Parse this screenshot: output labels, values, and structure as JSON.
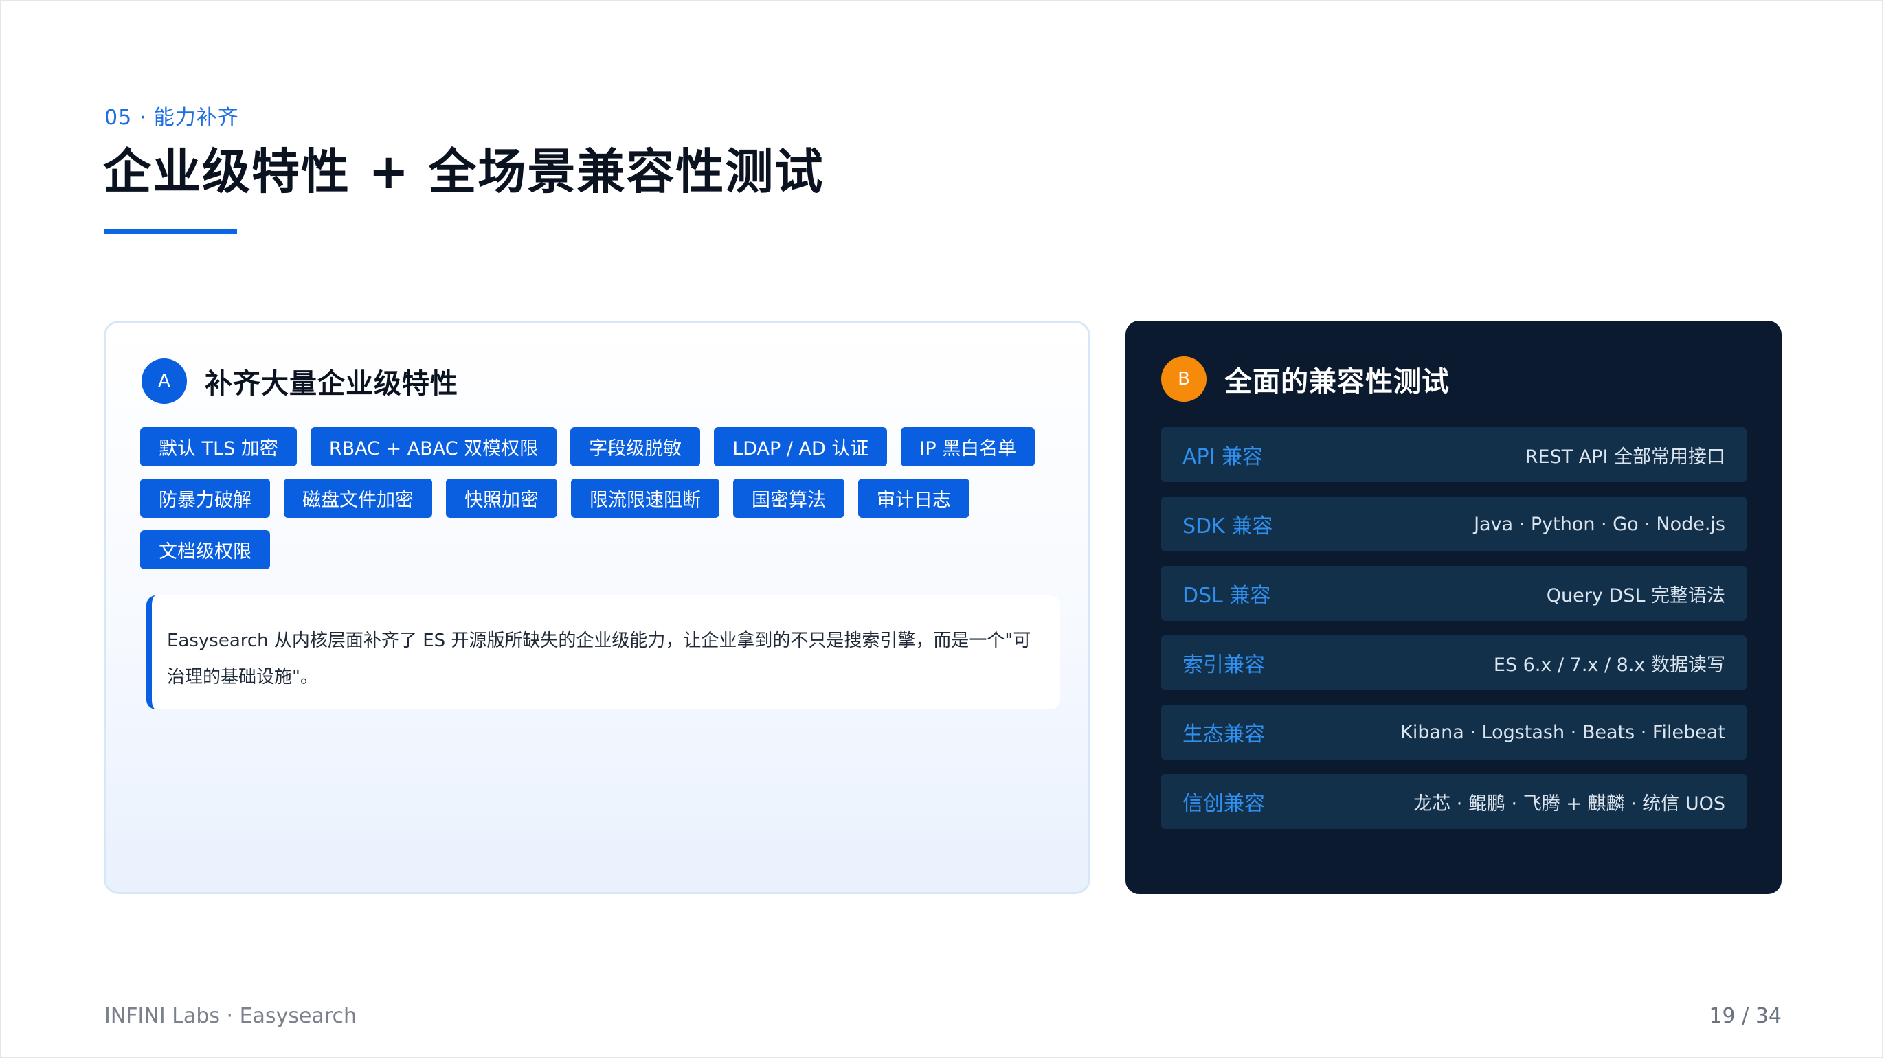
{
  "section_label": "05 · 能力补齐",
  "title": "企业级特性 + 全场景兼容性测试",
  "panel_a": {
    "badge": "A",
    "heading": "补齐大量企业级特性",
    "tags": [
      "默认 TLS 加密",
      "RBAC + ABAC 双模权限",
      "字段级脱敏",
      "LDAP / AD 认证",
      "IP 黑白名单",
      "防暴力破解",
      "磁盘文件加密",
      "快照加密",
      "限流限速阻断",
      "国密算法",
      "审计日志",
      "文档级权限"
    ],
    "quote": "Easysearch 从内核层面补齐了 ES 开源版所缺失的企业级能力，让企业拿到的不只是搜索引擎，而是一个\"可治理的基础设施\"。"
  },
  "panel_b": {
    "badge": "B",
    "heading": "全面的兼容性测试",
    "rows": [
      {
        "label": "API 兼容",
        "value": "REST API 全部常用接口"
      },
      {
        "label": "SDK 兼容",
        "value": "Java · Python · Go · Node.js"
      },
      {
        "label": "DSL 兼容",
        "value": "Query DSL 完整语法"
      },
      {
        "label": "索引兼容",
        "value": "ES 6.x / 7.x / 8.x 数据读写"
      },
      {
        "label": "生态兼容",
        "value": "Kibana · Logstash · Beats · Filebeat"
      },
      {
        "label": "信创兼容",
        "value": "龙芯 · 鲲鹏 · 飞腾 + 麒麟 · 统信 UOS"
      }
    ]
  },
  "footer": {
    "left": "INFINI Labs · Easysearch",
    "page": "19 / 34"
  },
  "colors": {
    "accent_blue": "#0a5fe0",
    "badge_orange": "#f58a0b",
    "dark_panel": "#0b1a2e",
    "row_bg": "#13304a",
    "row_label": "#2f90f0"
  }
}
